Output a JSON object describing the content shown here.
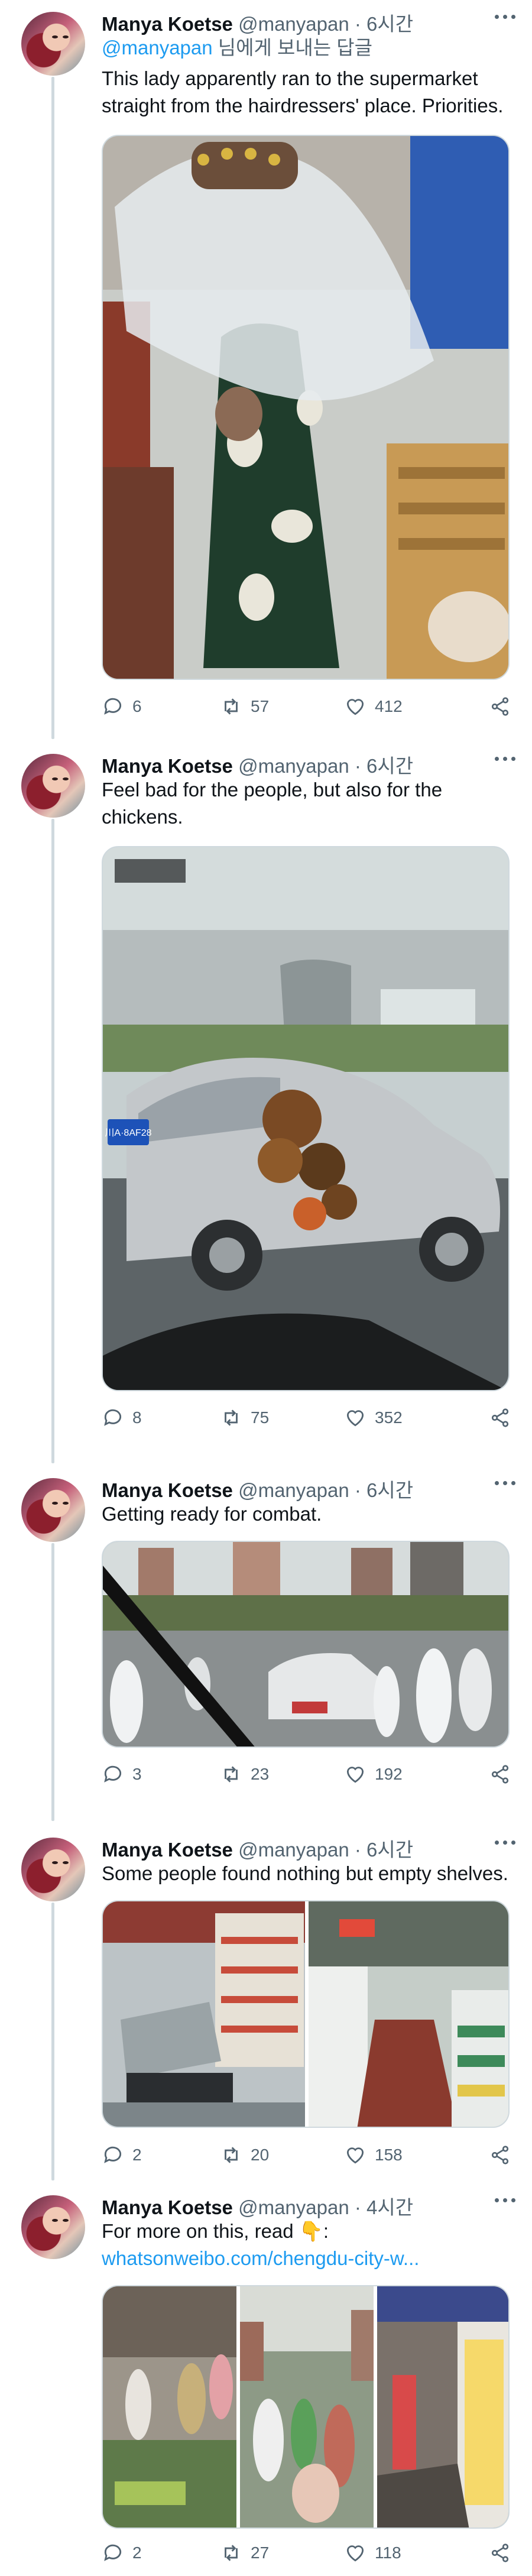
{
  "colors": {
    "link": "#1d9bf0",
    "muted": "#536471",
    "text": "#0f1419",
    "thread_line": "#cfd9de"
  },
  "tweets": [
    {
      "name": "Manya Koetse",
      "handle": "@manyapan",
      "dot": "·",
      "time": "6시간",
      "reply_mention": "@manyapan",
      "reply_suffix": " 님에게 보내는 답글",
      "text": "This lady apparently ran to the supermarket straight from the hairdressers' place. Priorities.",
      "replies": "6",
      "retweets": "57",
      "likes": "412"
    },
    {
      "name": "Manya Koetse",
      "handle": "@manyapan",
      "dot": "·",
      "time": "6시간",
      "text": "Feel bad for the people, but also for the chickens.",
      "plate": "川A·8AF28",
      "replies": "8",
      "retweets": "75",
      "likes": "352"
    },
    {
      "name": "Manya Koetse",
      "handle": "@manyapan",
      "dot": "·",
      "time": "6시간",
      "text": "Getting ready for combat.",
      "replies": "3",
      "retweets": "23",
      "likes": "192"
    },
    {
      "name": "Manya Koetse",
      "handle": "@manyapan",
      "dot": "·",
      "time": "6시간",
      "text": "Some people found nothing but empty shelves.",
      "replies": "2",
      "retweets": "20",
      "likes": "158"
    },
    {
      "name": "Manya Koetse",
      "handle": "@manyapan",
      "dot": "·",
      "time": "4시간",
      "text": "For more on this, read 👇:",
      "link": "whatsonweibo.com/chengdu-city-w...",
      "replies": "2",
      "retweets": "27",
      "likes": "118"
    }
  ]
}
